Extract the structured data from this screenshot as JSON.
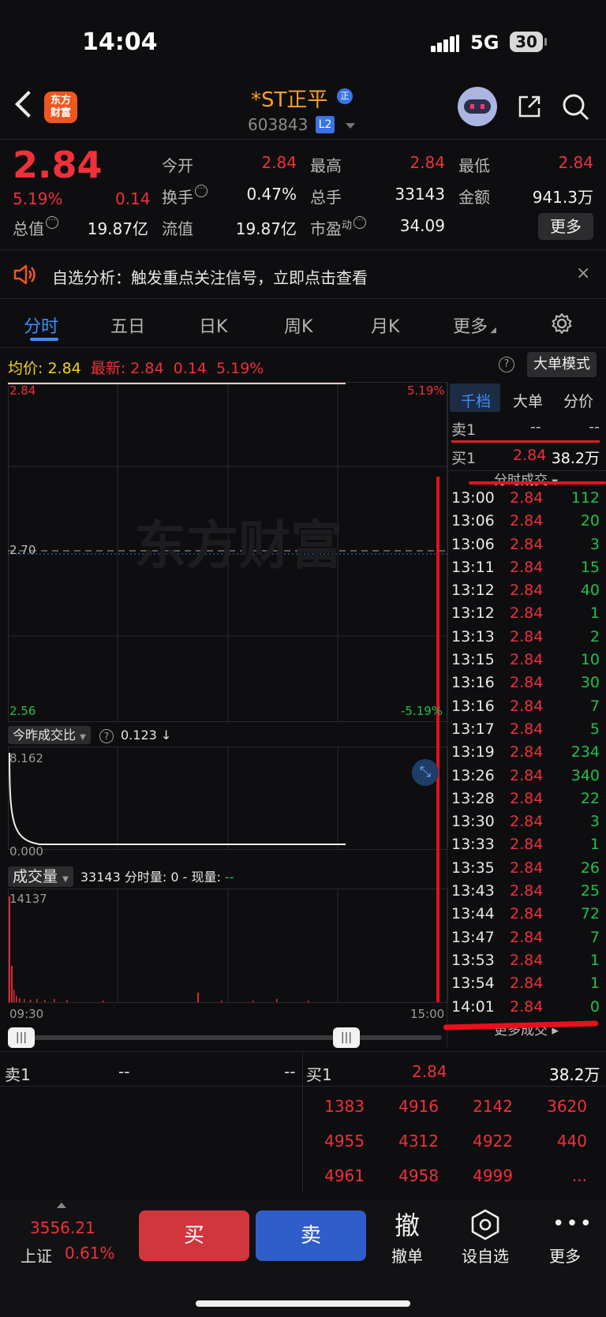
{
  "status_bar": {
    "time": "14:04",
    "network": "5G",
    "battery": "30"
  },
  "header": {
    "stock_name": "*ST正平",
    "badge": "正",
    "stock_code": "603843",
    "level_badge": "L2",
    "logo_text": "东方\n财富"
  },
  "quote": {
    "price": "2.84",
    "change_pct": "5.19%",
    "change": "0.14",
    "today_open_label": "今开",
    "today_open": "2.84",
    "high_label": "最高",
    "high": "2.84",
    "low_label": "最低",
    "low": "2.84",
    "turnover_label": "换手",
    "turnover": "0.47%",
    "total_vol_label": "总手",
    "total_vol": "33143",
    "amount_label": "金额",
    "amount": "941.3万",
    "mkt_cap_label": "总值",
    "mkt_cap": "19.87亿",
    "float_cap_label": "流值",
    "float_cap": "19.87亿",
    "pe_label": "市盈",
    "pe_sup": "动",
    "pe": "34.09",
    "more_label": "更多"
  },
  "notice": {
    "text": "自选分析：触发重点关注信号，立即点击查看",
    "close": "×"
  },
  "tabs": [
    {
      "label": "分时",
      "active": true
    },
    {
      "label": "五日",
      "active": false
    },
    {
      "label": "日K",
      "active": false
    },
    {
      "label": "周K",
      "active": false
    },
    {
      "label": "月K",
      "active": false
    },
    {
      "label": "更多",
      "active": false
    }
  ],
  "chart_header": {
    "avg_label": "均价:",
    "avg": "2.84",
    "latest_label": "最新:",
    "latest": "2.84",
    "latest_change": "0.14",
    "latest_pct": "5.19%",
    "big_order_label": "大单模式"
  },
  "price_chart": {
    "top_left": "2.84",
    "top_right": "5.19%",
    "mid": "2.70",
    "bottom_left": "2.56",
    "bottom_right": "-5.19%",
    "watermark": "东方财富"
  },
  "ratio_chart": {
    "selector": "今昨成交比",
    "value": "0.123 ↓",
    "top": "8.162",
    "bottom": "0.000"
  },
  "volume_chart": {
    "selector": "成交量",
    "info": "33143  分时量: 0 - 现量:",
    "info_dash": "--",
    "max": "14137",
    "time_start": "09:30",
    "time_end": "15:00"
  },
  "side_panel": {
    "tabs": [
      "千档",
      "大单",
      "分价"
    ],
    "sell1_label": "卖1",
    "sell1_price": "--",
    "sell1_vol": "--",
    "buy1_label": "买1",
    "buy1_price": "2.84",
    "buy1_vol": "38.2万",
    "trades_header": "分时成交",
    "trades": [
      {
        "time": "13:00",
        "price": "2.84",
        "vol": "112"
      },
      {
        "time": "13:06",
        "price": "2.84",
        "vol": "20"
      },
      {
        "time": "13:06",
        "price": "2.84",
        "vol": "3"
      },
      {
        "time": "13:11",
        "price": "2.84",
        "vol": "15"
      },
      {
        "time": "13:12",
        "price": "2.84",
        "vol": "40"
      },
      {
        "time": "13:12",
        "price": "2.84",
        "vol": "1"
      },
      {
        "time": "13:13",
        "price": "2.84",
        "vol": "2"
      },
      {
        "time": "13:15",
        "price": "2.84",
        "vol": "10"
      },
      {
        "time": "13:16",
        "price": "2.84",
        "vol": "30"
      },
      {
        "time": "13:16",
        "price": "2.84",
        "vol": "7"
      },
      {
        "time": "13:17",
        "price": "2.84",
        "vol": "5"
      },
      {
        "time": "13:19",
        "price": "2.84",
        "vol": "234"
      },
      {
        "time": "13:26",
        "price": "2.84",
        "vol": "340"
      },
      {
        "time": "13:28",
        "price": "2.84",
        "vol": "22"
      },
      {
        "time": "13:30",
        "price": "2.84",
        "vol": "3"
      },
      {
        "time": "13:33",
        "price": "2.84",
        "vol": "1"
      },
      {
        "time": "13:35",
        "price": "2.84",
        "vol": "26"
      },
      {
        "time": "13:43",
        "price": "2.84",
        "vol": "25"
      },
      {
        "time": "13:44",
        "price": "2.84",
        "vol": "72"
      },
      {
        "time": "13:47",
        "price": "2.84",
        "vol": "7"
      },
      {
        "time": "13:53",
        "price": "2.84",
        "vol": "1"
      },
      {
        "time": "13:54",
        "price": "2.84",
        "vol": "1"
      },
      {
        "time": "14:01",
        "price": "2.84",
        "vol": "0"
      }
    ],
    "more_trades": "更多成交"
  },
  "orderbook": {
    "sell1_label": "卖1",
    "sell1_price": "--",
    "sell1_vol": "--",
    "buy1_label": "买1",
    "buy1_price": "2.84",
    "buy1_vol": "38.2万",
    "queue": [
      [
        "1383",
        "4916",
        "2142",
        "3620"
      ],
      [
        "4955",
        "4312",
        "4922",
        "440"
      ],
      [
        "4961",
        "4958",
        "4999",
        "..."
      ]
    ]
  },
  "bottom_bar": {
    "index_value": "3556.21",
    "index_name": "上证",
    "index_pct": "0.61%",
    "buy": "买",
    "sell": "卖",
    "cancel_glyph": "撤",
    "cancel": "撤单",
    "watch": "设自选",
    "more": "更多"
  },
  "colors": {
    "up": "#f0303a",
    "down": "#22c04a",
    "accent": "#3e8ef7",
    "name": "#ff9e2c",
    "bg": "#0e0e10"
  }
}
